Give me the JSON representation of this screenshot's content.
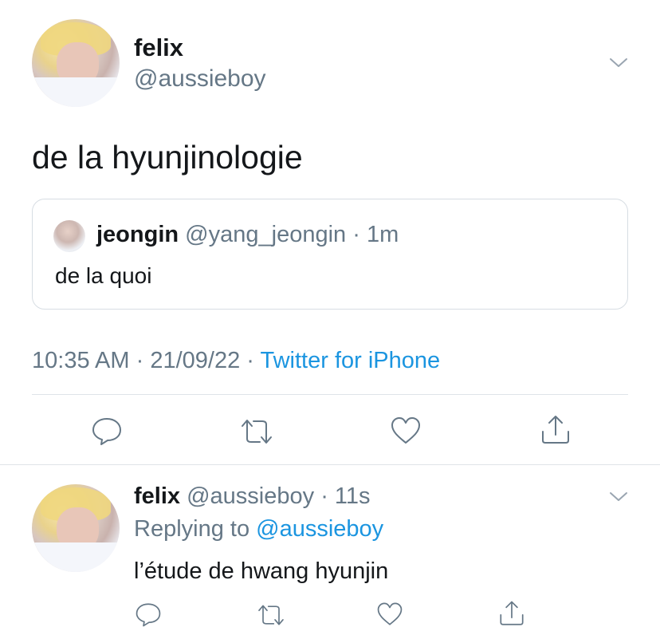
{
  "main_tweet": {
    "display_name": "felix",
    "handle": "@aussieboy",
    "text": "de la hyunjinologie",
    "quote": {
      "display_name": "jeongin",
      "handle": "@yang_jeongin",
      "separator": "·",
      "time": "1m",
      "text": "de la quoi"
    },
    "meta": {
      "time": "10:35 AM",
      "sep1": "·",
      "date": "21/09/22",
      "sep2": "·",
      "source": "Twitter for iPhone"
    },
    "actions": [
      "reply-icon",
      "retweet-icon",
      "like-icon",
      "share-icon"
    ]
  },
  "reply_tweet": {
    "display_name": "felix",
    "handle": "@aussieboy",
    "separator": "·",
    "time": "11s",
    "replying_prefix": "Replying to",
    "replying_handle": "@aussieboy",
    "text": "l’étude de hwang hyunjin",
    "actions": [
      "reply-icon",
      "retweet-icon",
      "like-icon",
      "share-icon"
    ]
  },
  "colors": {
    "accent": "#1b95e0",
    "muted": "#657786",
    "text": "#14171a",
    "divider": "#dfe4e8"
  }
}
